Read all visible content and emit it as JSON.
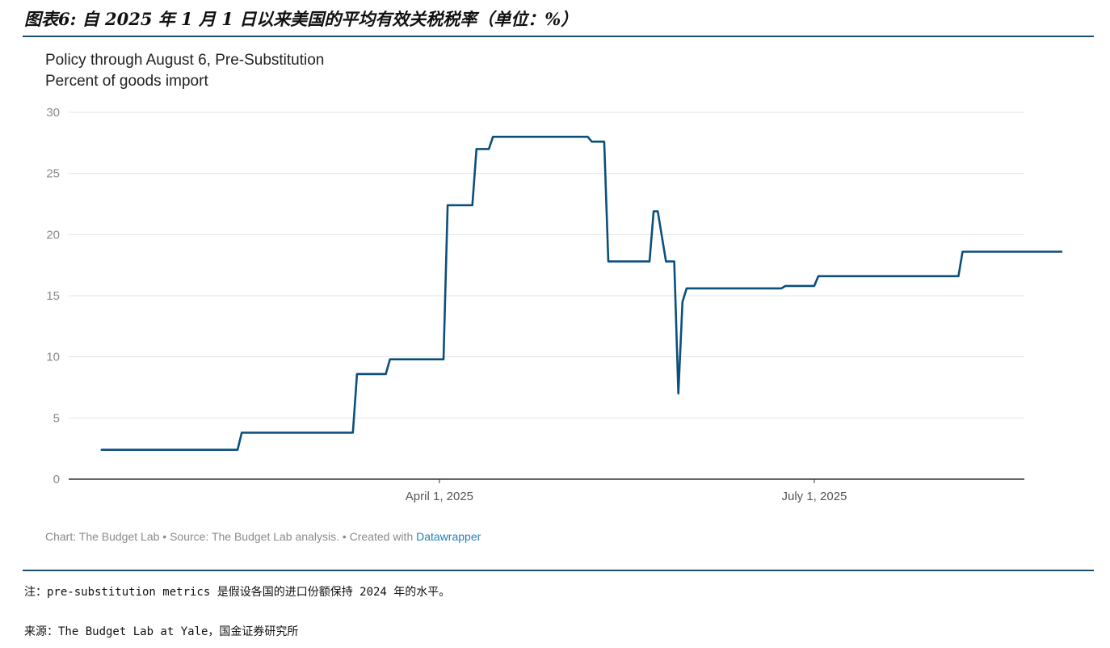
{
  "figure": {
    "title": "图表6: 自 2025 年 1 月 1 日以来美国的平均有效关税税率（单位：%）",
    "note": "注：pre-substitution metrics 是假设各国的进口份额保持 2024 年的水平。",
    "source": "来源：The Budget Lab at Yale，国金证券研究所"
  },
  "chart_data": {
    "type": "line",
    "title": "",
    "subtitle_lines": [
      "Policy through August 6, Pre-Substitution",
      "Percent of goods import"
    ],
    "xlabel": "",
    "ylabel": "",
    "ylim": [
      0,
      30
    ],
    "xlim": [
      "2025-01-01",
      "2025-08-21"
    ],
    "y_ticks": [
      0,
      5,
      10,
      15,
      20,
      25,
      30
    ],
    "x_ticks": [
      {
        "date": "2025-04-01",
        "label": "April 1, 2025"
      },
      {
        "date": "2025-07-01",
        "label": "July 1, 2025"
      }
    ],
    "grid": "horizontal",
    "legend": "none",
    "series": [
      {
        "name": "",
        "color": "#0b4f7c",
        "points": [
          [
            "2025-01-09",
            2.4
          ],
          [
            "2025-02-11",
            2.4
          ],
          [
            "2025-02-12",
            3.8
          ],
          [
            "2025-03-11",
            3.8
          ],
          [
            "2025-03-12",
            8.6
          ],
          [
            "2025-03-19",
            8.6
          ],
          [
            "2025-03-20",
            9.8
          ],
          [
            "2025-04-02",
            9.8
          ],
          [
            "2025-04-03",
            22.4
          ],
          [
            "2025-04-09",
            22.4
          ],
          [
            "2025-04-10",
            27.0
          ],
          [
            "2025-04-13",
            27.0
          ],
          [
            "2025-04-14",
            28.0
          ],
          [
            "2025-05-07",
            28.0
          ],
          [
            "2025-05-08",
            27.6
          ],
          [
            "2025-05-11",
            27.6
          ],
          [
            "2025-05-12",
            17.8
          ],
          [
            "2025-05-22",
            17.8
          ],
          [
            "2025-05-23",
            21.9
          ],
          [
            "2025-05-24",
            21.9
          ],
          [
            "2025-05-26",
            17.8
          ],
          [
            "2025-05-28",
            17.8
          ],
          [
            "2025-05-29",
            7.0
          ],
          [
            "2025-05-30",
            14.5
          ],
          [
            "2025-05-31",
            15.6
          ],
          [
            "2025-06-23",
            15.6
          ],
          [
            "2025-06-24",
            15.8
          ],
          [
            "2025-07-01",
            15.8
          ],
          [
            "2025-07-02",
            16.6
          ],
          [
            "2025-08-05",
            16.6
          ],
          [
            "2025-08-06",
            18.6
          ],
          [
            "2025-08-30",
            18.6
          ]
        ]
      }
    ]
  },
  "footer": {
    "credit_prefix": "Chart: The Budget Lab • Source: The Budget Lab analysis. • Created with ",
    "credit_link": "Datawrapper"
  }
}
